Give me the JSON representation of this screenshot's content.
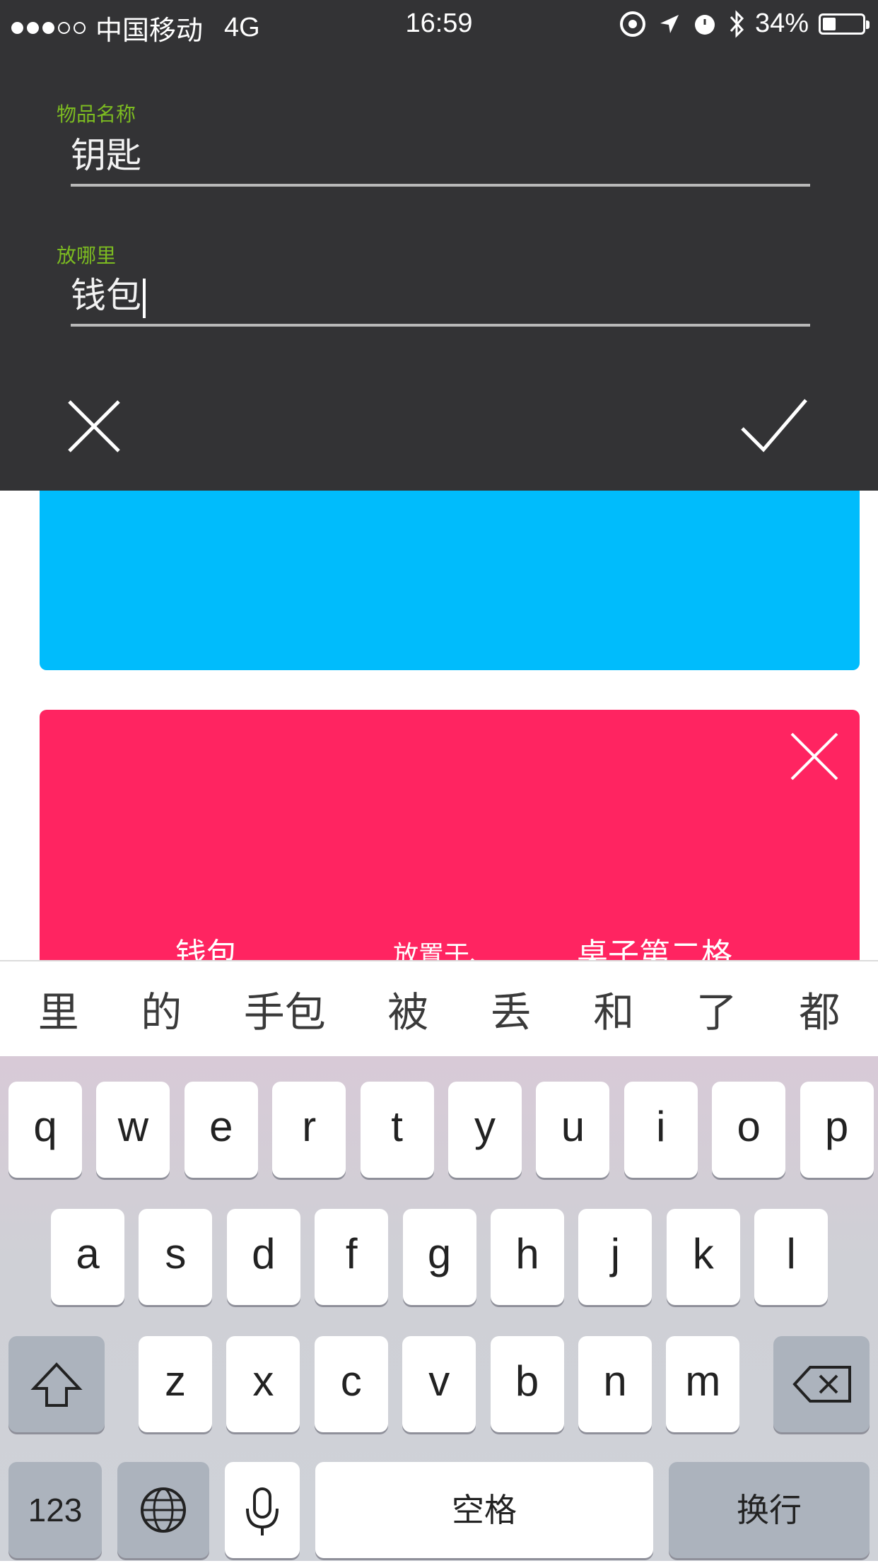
{
  "status_bar": {
    "carrier": "中国移动",
    "network": "4G",
    "time": "16:59",
    "battery": "34%",
    "battery_level": 0.34
  },
  "dialog": {
    "field1": {
      "label": "物品名称",
      "value": "钥匙"
    },
    "field2": {
      "label": "放哪里",
      "value": "钱包"
    },
    "label_color": "#7cbb21"
  },
  "card": {
    "texts": [
      "钱包",
      "放置于、",
      "桌子第二格"
    ]
  },
  "colors": {
    "dialog_bg": "#333335",
    "card_blue": "#00bcfc",
    "card_red": "#ff2461"
  },
  "keyboard": {
    "candidates": [
      "里",
      "的",
      "手包",
      "被",
      "丢",
      "和",
      "了",
      "都"
    ],
    "row1": [
      "q",
      "w",
      "e",
      "r",
      "t",
      "y",
      "u",
      "i",
      "o",
      "p"
    ],
    "row2": [
      "a",
      "s",
      "d",
      "f",
      "g",
      "h",
      "j",
      "k",
      "l"
    ],
    "row3": [
      "z",
      "x",
      "c",
      "v",
      "b",
      "n",
      "m"
    ],
    "numbers_key": "123",
    "space_key": "空格",
    "return_key": "换行",
    "icons": [
      "shift-icon",
      "backspace-icon",
      "globe-icon",
      "microphone-icon"
    ]
  }
}
